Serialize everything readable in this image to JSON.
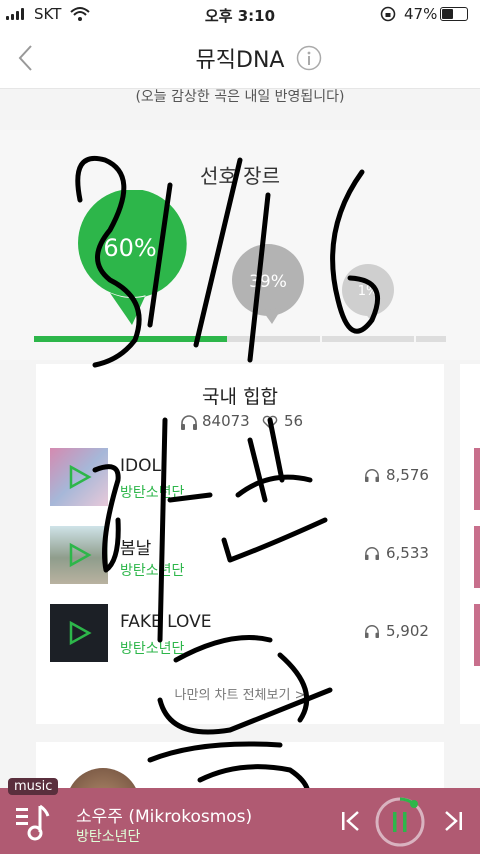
{
  "status": {
    "carrier": "SKT",
    "time": "오후 3:10",
    "battery": "47%"
  },
  "header": {
    "title": "뮤직DNA"
  },
  "notice": "(오늘 감상한 곡은 내일 반영됩니다)",
  "genre": {
    "title": "선호 장르",
    "bubbles": [
      {
        "label": "60%",
        "value": 0.6
      },
      {
        "label": "39%",
        "value": 0.39
      },
      {
        "label": "1%",
        "value": 0.01
      }
    ],
    "progress": 0.6
  },
  "card": {
    "genre_name": "국내 힙합",
    "listens": "84073",
    "likes": "56",
    "tracks": [
      {
        "title": "IDOL",
        "artist": "방탄소년단",
        "plays": "8,576"
      },
      {
        "title": "봄날",
        "artist": "방탄소년단",
        "plays": "6,533"
      },
      {
        "title": "FAKE LOVE",
        "artist": "방탄소년단",
        "plays": "5,902"
      }
    ],
    "view_all": "나만의 차트 전체보기 >"
  },
  "player": {
    "badge": "music",
    "song": "소우주 (Mikrokosmos)",
    "artist": "방탄소년단"
  },
  "colors": {
    "accent": "#2db64a",
    "player_bg": "#b05a72",
    "grey_bubble": "#b3b3b3"
  },
  "icons": [
    "back-icon",
    "info-icon",
    "wifi-icon",
    "battery-icon",
    "play-icon",
    "headphones-icon",
    "heart-icon",
    "music-note-icon",
    "prev-icon",
    "next-icon",
    "pause-icon"
  ]
}
